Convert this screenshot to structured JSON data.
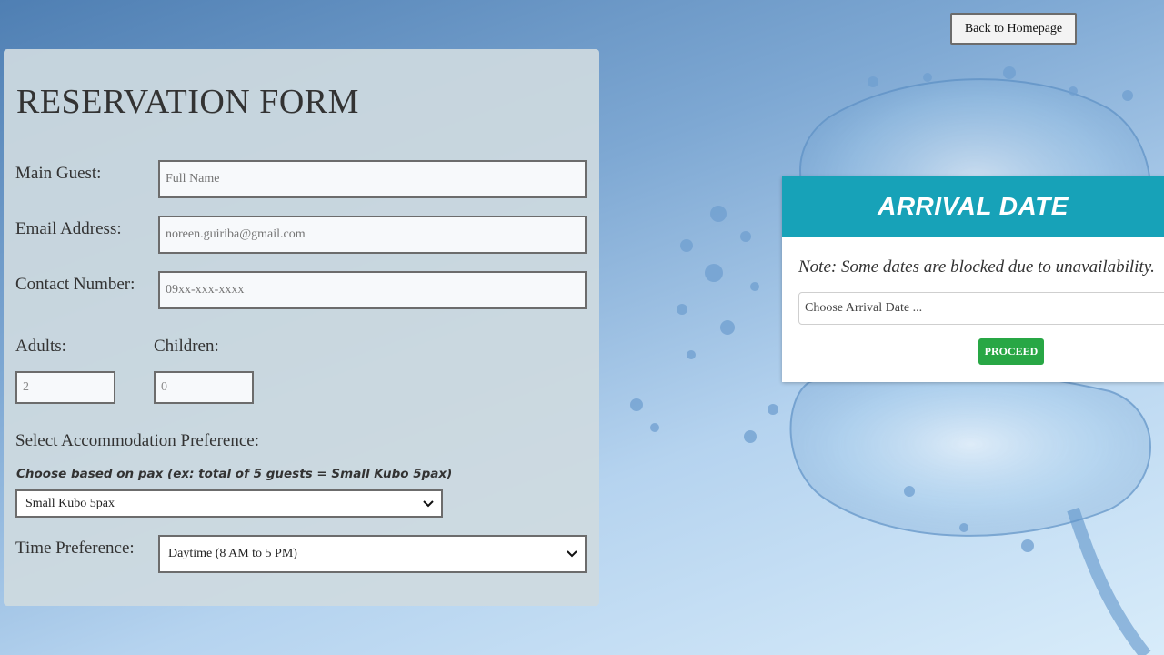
{
  "nav": {
    "back_label": "Back to Homepage"
  },
  "form": {
    "title": "RESERVATION FORM",
    "main_guest": {
      "label": "Main Guest:",
      "placeholder": "Full Name",
      "value": ""
    },
    "email": {
      "label": "Email Address:",
      "placeholder": "noreen.guiriba@gmail.com",
      "value": ""
    },
    "contact": {
      "label": "Contact Number:",
      "placeholder": "09xx-xxx-xxxx",
      "value": ""
    },
    "adults": {
      "label": "Adults:",
      "placeholder": "2"
    },
    "children": {
      "label": "Children:",
      "placeholder": "0"
    },
    "accommodation": {
      "label": "Select Accommodation Preference:",
      "note": "Choose based on pax (ex: total of 5 guests = Small Kubo 5pax)",
      "selected": "Small Kubo 5pax"
    },
    "time": {
      "label": "Time Preference:",
      "selected": "Daytime (8 AM to 5 PM)"
    }
  },
  "arrival": {
    "title": "ARRIVAL DATE",
    "note": "Note: Some dates are blocked due to unavailability.",
    "date_placeholder": "Choose Arrival Date ...",
    "proceed_label": "PROCEED"
  },
  "colors": {
    "header_teal": "#17a2b8",
    "proceed_green": "#28a745",
    "panel_bg": "#ced9de"
  },
  "icons": [
    "chevron-down-icon",
    "water-splash-image"
  ]
}
